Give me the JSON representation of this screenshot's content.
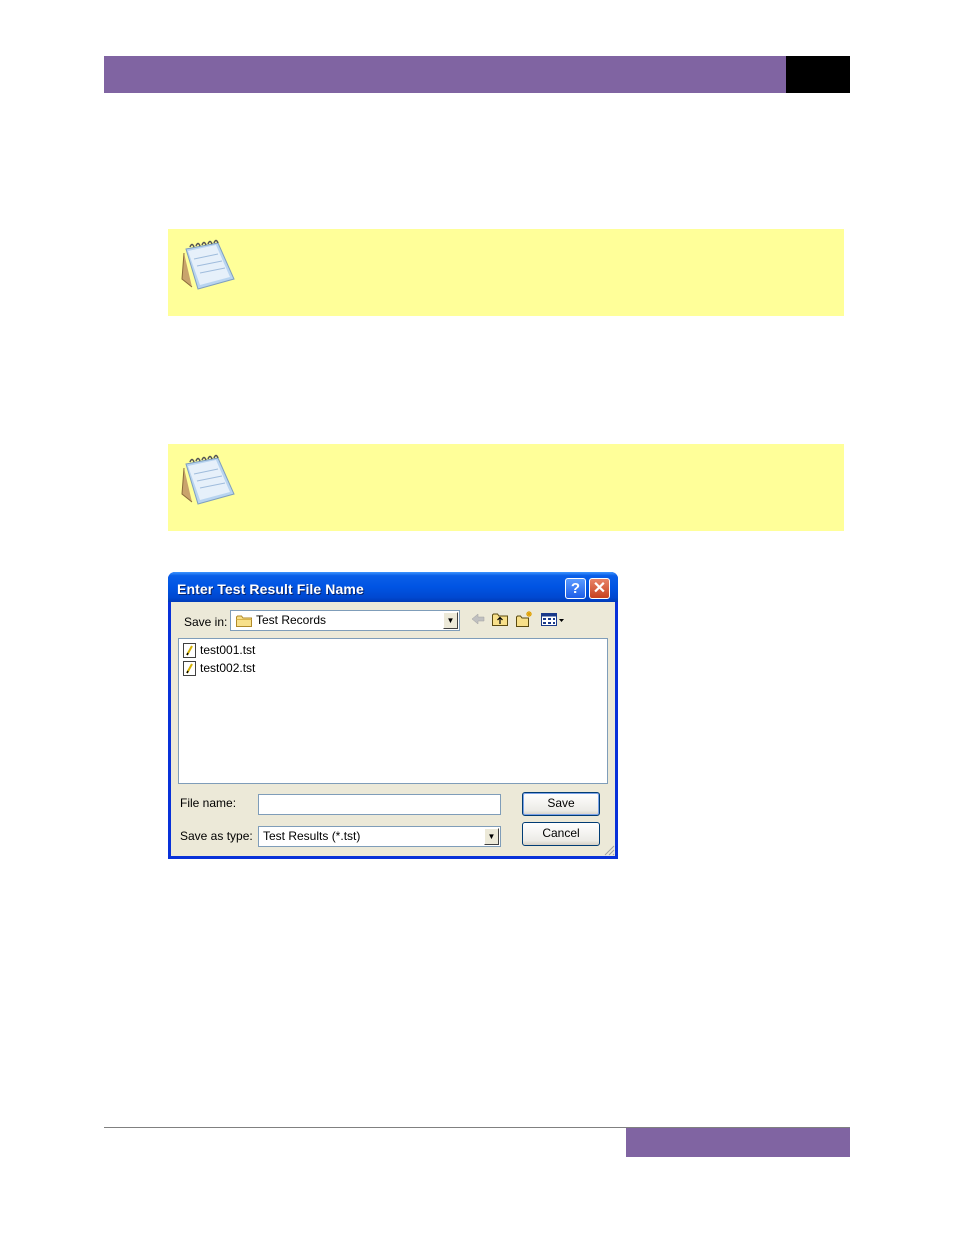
{
  "dialog": {
    "title": "Enter Test Result File Name",
    "help_label": "?",
    "close_label": "✕",
    "save_in_label": "Save in:",
    "save_in_value": "Test Records",
    "files": [
      "test001.tst",
      "test002.tst"
    ],
    "file_name_label": "File name:",
    "file_name_value": "",
    "save_as_type_label": "Save as type:",
    "save_as_type_value": "Test Results (*.tst)",
    "save_button": "Save",
    "cancel_button": "Cancel"
  },
  "icons": {
    "note": "notepad-icon",
    "folder": "folder-icon",
    "back": "back-arrow-icon",
    "up": "up-folder-icon",
    "new_folder": "new-folder-icon",
    "views": "view-menu-icon"
  },
  "colors": {
    "header": "#8064a2",
    "note_background": "#ffff99",
    "titlebar": "#0054e3",
    "dialog_face": "#ece9d8"
  }
}
